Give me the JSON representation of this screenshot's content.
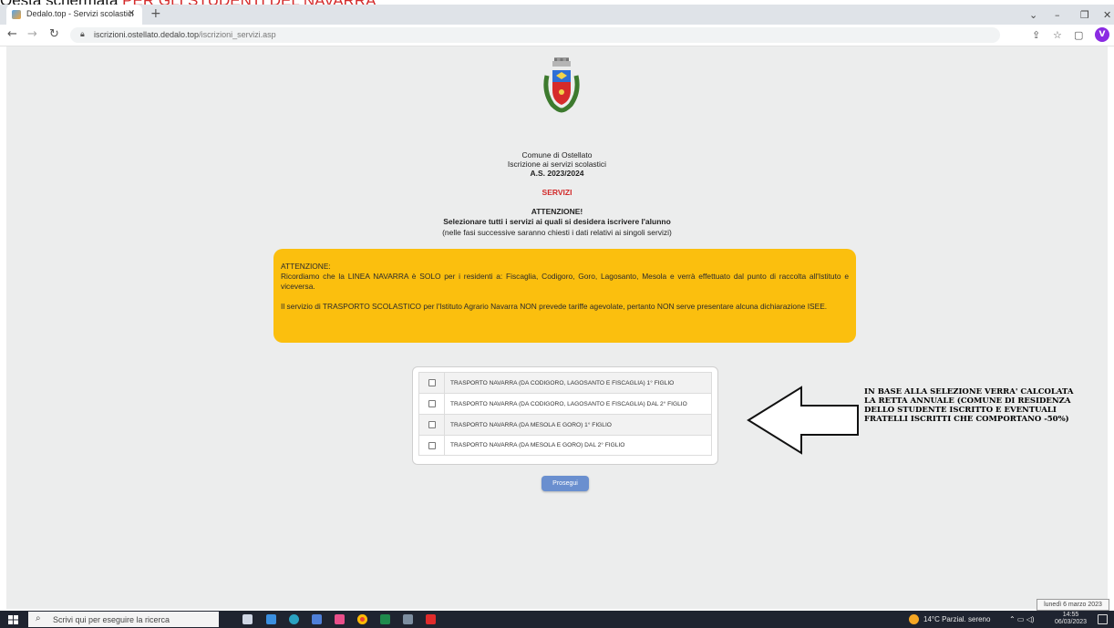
{
  "caption": {
    "prefix": "Qesta schermata ",
    "highlight": "PER GLI STUDENTI DEL NAVARRA"
  },
  "browser": {
    "tab_title": "Dedalo.top - Servizi scolastici",
    "tab_close": "×",
    "new_tab": "+",
    "url_host": "iscrizioni.ostellato.dedalo.top",
    "url_path": "/iscrizioni_servizi.asp",
    "profile_initial": "V",
    "icons": [
      "back-icon",
      "forward-icon",
      "reload-icon",
      "lock-icon",
      "share-icon",
      "star-icon",
      "sidebar-icon"
    ]
  },
  "page": {
    "org": "Comune di Ostellato",
    "subtitle": "Iscrizione ai servizi scolastici",
    "year": "A.S. 2023/2024",
    "section": "SERVIZI",
    "attention": "ATTENZIONE!",
    "instruction": "Selezionare tutti i servizi ai quali si desidera iscrivere l'alunno",
    "note": "(nelle fasi successive saranno chiesti i dati relativi ai singoli servizi)"
  },
  "notice": {
    "title": "ATTENZIONE:",
    "line1": "Ricordiamo che la LINEA NAVARRA è SOLO per i residenti a: Fiscaglia, Codigoro, Goro, Lagosanto, Mesola e verrà effettuato dal punto di raccolta all'Istituto e viceversa.",
    "line2": "Il servizio di TRASPORTO SCOLASTICO per l'Istituto Agrario Navarra NON prevede tariffe agevolate, pertanto NON serve presentare alcuna dichiarazione ISEE.",
    "color": "#fbbf0e"
  },
  "services": [
    {
      "label": "TRASPORTO NAVARRA (DA CODIGORO, LAGOSANTO E FISCAGLIA) 1° FIGLIO",
      "checked": false
    },
    {
      "label": "TRASPORTO NAVARRA (DA CODIGORO, LAGOSANTO E FISCAGLIA) DAL 2° FIGLIO",
      "checked": false
    },
    {
      "label": "TRASPORTO NAVARRA (DA MESOLA E GORO) 1° FIGLIO",
      "checked": false
    },
    {
      "label": "TRASPORTO NAVARRA (DA MESOLA E GORO) DAL 2° FIGLIO",
      "checked": false
    }
  ],
  "side_note": "IN BASE ALLA SELEZIONE VERRA' CALCOLATA LA RETTA ANNUALE (COMUNE DI RESIDENZA DELLO STUDENTE ISCRITTO E EVENTUALI FRATELLI ISCRITTI CHE COMPORTANO -50%)",
  "proceed_label": "Prosegui",
  "proceed_color": "#6a8fcf",
  "taskbar": {
    "search_placeholder": "Scrivi qui per eseguire la ricerca",
    "weather": "14°C Parzial. sereno",
    "time": "14:55",
    "date_short": "06/03/2023",
    "date_tooltip": "lunedì 6 marzo 2023",
    "apps": [
      "task-view-icon",
      "file-explorer-icon",
      "edge-icon",
      "store-icon",
      "paint-icon",
      "chrome-icon",
      "excel-icon",
      "app-icon",
      "acrobat-icon"
    ]
  }
}
